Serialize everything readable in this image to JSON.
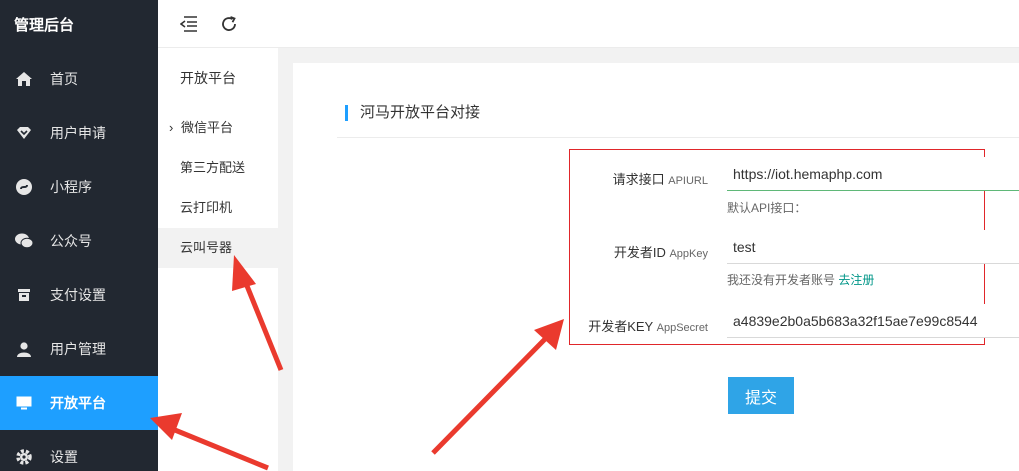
{
  "sidebar": {
    "brand": "管理后台",
    "items": [
      {
        "label": "首页",
        "icon": "home-icon"
      },
      {
        "label": "用户申请",
        "icon": "heart-icon"
      },
      {
        "label": "小程序",
        "icon": "miniapp-icon"
      },
      {
        "label": "公众号",
        "icon": "wechat-icon"
      },
      {
        "label": "支付设置",
        "icon": "payment-icon"
      },
      {
        "label": "用户管理",
        "icon": "user-icon"
      },
      {
        "label": "开放平台",
        "icon": "monitor-icon",
        "active": true
      },
      {
        "label": "设置",
        "icon": "gear-icon"
      }
    ]
  },
  "topbar": {
    "icons": [
      "collapse-menu-icon",
      "refresh-icon"
    ]
  },
  "submenu": {
    "title": "开放平台",
    "items": [
      {
        "label": "微信平台",
        "has_caret": true
      },
      {
        "label": "第三方配送"
      },
      {
        "label": "云打印机"
      },
      {
        "label": "云叫号器",
        "selected": true
      }
    ]
  },
  "card": {
    "title": "河马开放平台对接",
    "fields": [
      {
        "label": "请求接口",
        "label_en": "APIURL",
        "value": "https://iot.hemaphp.com",
        "help": "默认API接口："
      },
      {
        "label": "开发者ID",
        "label_en": "AppKey",
        "value": "test",
        "help": "我还没有开发者账号",
        "help_link": "去注册"
      },
      {
        "label": "开发者KEY",
        "label_en": "AppSecret",
        "value": "a4839e2b0a5b683a32f15ae7e99c8544"
      }
    ],
    "submit_label": "提交"
  },
  "colors": {
    "sidebar_bg": "#222831",
    "accent": "#1e9fff",
    "highlight": "#e0262a",
    "link": "#009688",
    "button": "#2fa4e7"
  }
}
